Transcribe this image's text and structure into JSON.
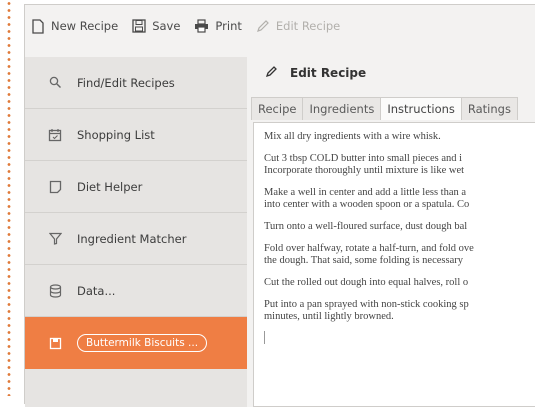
{
  "toolbar": {
    "new_label": "New Recipe",
    "save_label": "Save",
    "print_label": "Print",
    "edit_label": "Edit Recipe"
  },
  "sidebar": {
    "items": [
      {
        "label": "Find/Edit Recipes",
        "icon": "search-icon"
      },
      {
        "label": "Shopping List",
        "icon": "calendar-icon"
      },
      {
        "label": "Diet Helper",
        "icon": "note-icon"
      },
      {
        "label": "Ingredient Matcher",
        "icon": "funnel-icon"
      },
      {
        "label": "Data...",
        "icon": "database-icon"
      }
    ],
    "active_item": {
      "label": "Buttermilk Biscuits ...",
      "icon": "recipe-icon"
    }
  },
  "main": {
    "title": "Edit Recipe",
    "tabs": [
      "Recipe",
      "Ingredients",
      "Instructions",
      "Ratings"
    ],
    "active_tab": "Instructions",
    "instructions": [
      [
        "Mix all dry ingredients with a wire whisk."
      ],
      [
        "Cut 3 tbsp COLD butter into small pieces and i",
        "Incorporate thoroughly until mixture is like wet"
      ],
      [
        "Make a well in center and add a little less than a",
        "into center with a wooden spoon or a spatula. Co"
      ],
      [
        "Turn onto a well-floured surface, dust dough bal"
      ],
      [
        "Fold over halfway, rotate a half-turn, and fold ove",
        "the dough. That said, some folding is necessary"
      ],
      [
        "Cut the rolled out dough into equal halves, roll o"
      ],
      [
        "Put into a pan sprayed with non-stick cooking sp",
        "minutes, until lightly browned."
      ]
    ]
  },
  "colors": {
    "accent": "#ef7e44",
    "sidebar_bg": "#e6e4e2",
    "window_bg": "#f3f2f1"
  }
}
